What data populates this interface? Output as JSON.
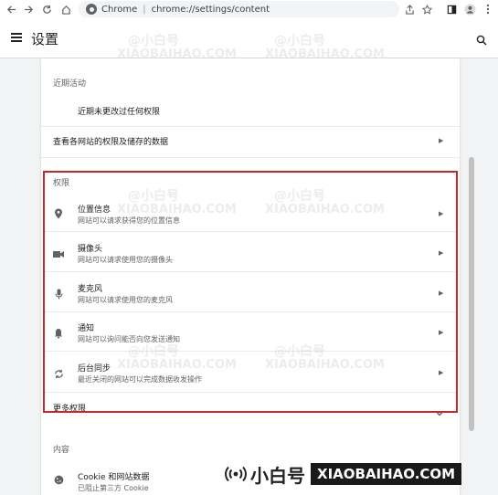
{
  "browser": {
    "chrome_label": "Chrome",
    "url": "chrome://settings/content"
  },
  "header": {
    "title": "设置"
  },
  "recent": {
    "section_label": "近期活动",
    "empty_text": "近期未更改过任何权限"
  },
  "site_data_link": "查看各网站的权限及储存的数据",
  "permissions": {
    "section_label": "权限",
    "items": [
      {
        "title": "位置信息",
        "subtitle": "网站可以请求获得您的位置信息",
        "icon": "location-icon"
      },
      {
        "title": "摄像头",
        "subtitle": "网站可以请求使用您的摄像头",
        "icon": "camera-icon"
      },
      {
        "title": "麦克风",
        "subtitle": "网站可以请求使用您的麦克风",
        "icon": "microphone-icon"
      },
      {
        "title": "通知",
        "subtitle": "网站可以询问能否向您发送通知",
        "icon": "bell-icon"
      },
      {
        "title": "后台同步",
        "subtitle": "最近关闭的网站可以完成数据收发操作",
        "icon": "sync-icon"
      }
    ],
    "more_label": "更多权限"
  },
  "content": {
    "section_label": "内容",
    "cookie_title": "Cookie 和网站数据",
    "cookie_subtitle": "已阻止第三方 Cookie"
  },
  "watermark": {
    "cn": "@小白号",
    "en": "XIAOBAIHAO.COM",
    "logo_cn": "小白号",
    "logo_en": "XIAOBAIHAO.COM"
  },
  "colors": {
    "highlight_border": "#c62828",
    "background": "#f1f3f4",
    "card": "#ffffff"
  }
}
